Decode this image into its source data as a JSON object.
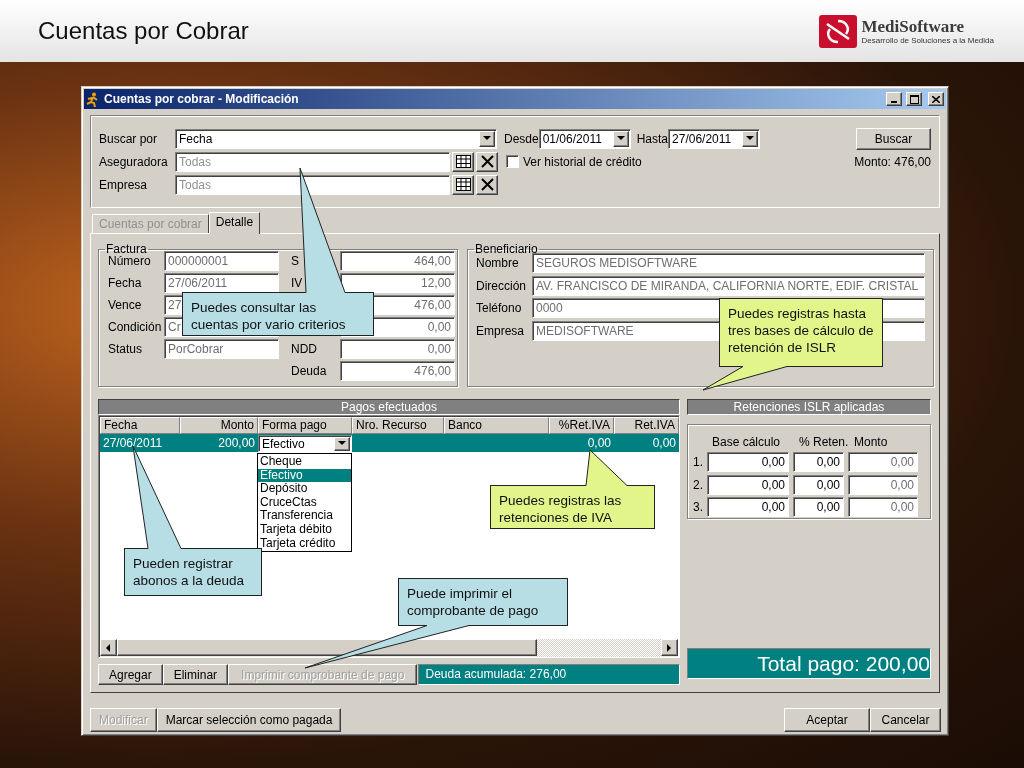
{
  "slide": {
    "title": "Cuentas por Cobrar",
    "logo_name": "MediSoftware",
    "logo_tagline": "Desarrollo de Soluciones a la Medida"
  },
  "window": {
    "title": "Cuentas por cobrar - Modificación"
  },
  "search": {
    "buscar_por": {
      "label": "Buscar por",
      "value": "Fecha"
    },
    "desde": {
      "label": "Desde",
      "value": "01/06/2011"
    },
    "hasta": {
      "label": "Hasta",
      "value": "27/06/2011"
    },
    "aseguradora": {
      "label": "Aseguradora",
      "placeholder": "Todas"
    },
    "empresa": {
      "label": "Empresa",
      "placeholder": "Todas"
    },
    "historial": {
      "label": "Ver historial de crédito",
      "checked": false
    },
    "button": "Buscar",
    "monto": "Monto: 476,00"
  },
  "tabs": [
    {
      "label": "Cuentas por cobrar",
      "selected": false
    },
    {
      "label": "Detalle",
      "selected": true
    }
  ],
  "factura": {
    "title": "Factura",
    "left": [
      {
        "label": "Número",
        "value": "000000001"
      },
      {
        "label": "Fecha",
        "value": "27/06/2011"
      },
      {
        "label": "Vence",
        "value": "27"
      },
      {
        "label": "Condición",
        "value": "Cr"
      },
      {
        "label": "Status",
        "value": "PorCobrar"
      }
    ],
    "right": [
      {
        "label": "S",
        "value": "464,00"
      },
      {
        "label": "IV",
        "value": "12,00"
      },
      {
        "value": "476,00"
      },
      {
        "value": "0,00"
      },
      {
        "label": "NDD",
        "value": "0,00"
      },
      {
        "label": "Deuda",
        "value": "476,00"
      }
    ]
  },
  "beneficiario": {
    "title": "Beneficiario",
    "fields": [
      {
        "label": "Nombre",
        "value": "SEGUROS MEDISOFTWARE"
      },
      {
        "label": "Dirección",
        "value": "AV. FRANCISCO DE MIRANDA, CALIFORNIA NORTE, EDIF. CRISTAL"
      },
      {
        "label": "Teléfono",
        "value": "0000"
      },
      {
        "label": "Empresa",
        "value": "MEDISOFTWARE"
      }
    ]
  },
  "payments": {
    "title": "Pagos efectuados",
    "columns": [
      "Fecha",
      "Monto",
      "Forma pago",
      "Nro. Recurso",
      "Banco",
      "%Ret.IVA",
      "Ret.IVA"
    ],
    "rows": [
      {
        "fecha": "27/06/2011",
        "monto": "200,00",
        "forma_pago": "Efectivo",
        "pct_ret_iva": "0,00",
        "ret_iva": "0,00",
        "selected": true
      }
    ]
  },
  "dropdown": {
    "options": [
      {
        "label": "Cheque",
        "selected": false
      },
      {
        "label": "Efectivo",
        "selected": true
      },
      {
        "label": "Depósito",
        "selected": false
      },
      {
        "label": "CruceCtas",
        "selected": false
      },
      {
        "label": "Transferencia",
        "selected": false
      },
      {
        "label": "Tarjeta débito",
        "selected": false
      },
      {
        "label": "Tarjeta crédito",
        "selected": false
      }
    ]
  },
  "islr": {
    "title": "Retenciones ISLR aplicadas",
    "columns": [
      "Base cálculo",
      "% Reten.",
      "Monto"
    ],
    "rows": [
      {
        "index": "1.",
        "base": "0,00",
        "pct": "0,00",
        "monto": "0,00"
      },
      {
        "index": "2.",
        "base": "0,00",
        "pct": "0,00",
        "monto": "0,00"
      },
      {
        "index": "3.",
        "base": "0,00",
        "pct": "0,00",
        "monto": "0,00"
      }
    ]
  },
  "actions": [
    {
      "label": "Agregar",
      "disabled": false
    },
    {
      "label": "Eliminar",
      "disabled": false
    },
    {
      "label": "Imprimir comprobante de pago",
      "disabled": true
    }
  ],
  "deuda": "Deuda acumulada: 276,00",
  "total": "Total pago: 200,00",
  "footer_buttons": [
    {
      "label": "Modificar",
      "disabled": true
    },
    {
      "label": "Marcar selección como pagada",
      "disabled": false
    },
    {
      "label": "Aceptar",
      "disabled": false
    },
    {
      "label": "Cancelar",
      "disabled": false
    }
  ],
  "callouts": [
    {
      "text": "Puedes consultar las cuentas por vario criterios",
      "color": "#b7dde5"
    },
    {
      "text": "Puedes registras hasta tres bases de cálculo de retención de ISLR",
      "color": "#e1f58a"
    },
    {
      "text": "Puedes registras las retenciones de IVA",
      "color": "#e1f58a"
    },
    {
      "text": "Pueden registrar abonos a la deuda",
      "color": "#b7dde5"
    },
    {
      "text": "Puede imprimir el comprobante de pago",
      "color": "#b7dde5"
    }
  ]
}
